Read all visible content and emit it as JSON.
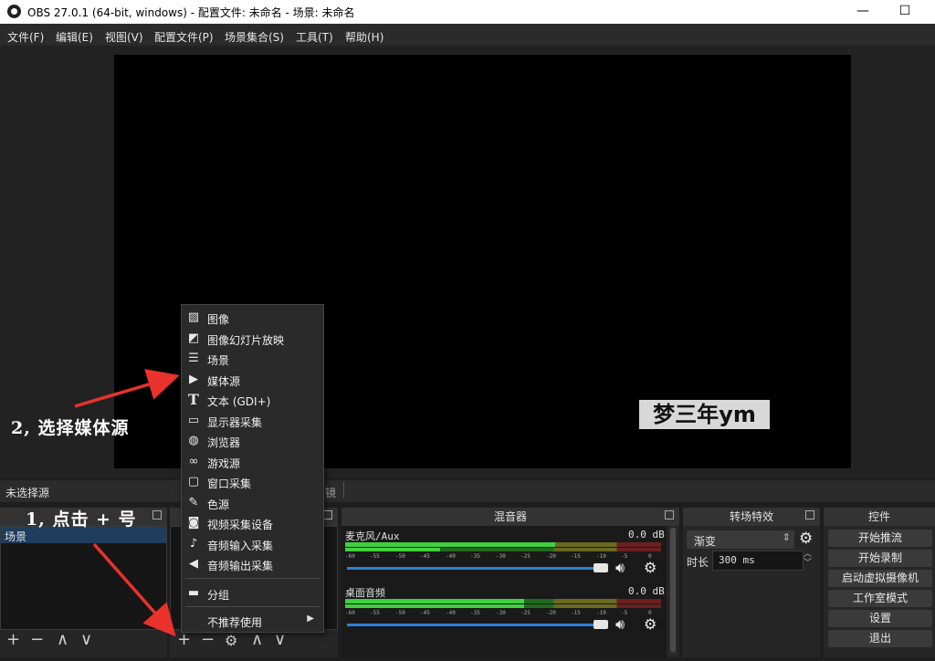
{
  "window": {
    "title": "OBS 27.0.1 (64-bit, windows) - 配置文件: 未命名 - 场景: 未命名",
    "minimize": "—",
    "maximize": "☐"
  },
  "menu": [
    "文件(F)",
    "编辑(E)",
    "视图(V)",
    "配置文件(P)",
    "场景集合(S)",
    "工具(T)",
    "帮助(H)"
  ],
  "preview": {
    "watermark_text": "梦三年ym"
  },
  "source_bar": {
    "no_source": "未选择源",
    "filter_tail": "镜"
  },
  "scenes": {
    "items": [
      "场景"
    ]
  },
  "mixer": {
    "title": "混音器",
    "channels": [
      {
        "name": "麦克风/Aux",
        "level": "0.0 dB"
      },
      {
        "name": "桌面音频",
        "level": "0.0 dB"
      }
    ],
    "scale": [
      "-60",
      "-55",
      "-50",
      "-45",
      "-40",
      "-35",
      "-30",
      "-25",
      "-20",
      "-15",
      "-10",
      "-5",
      "0"
    ]
  },
  "transitions": {
    "title": "转场特效",
    "selected": "渐变",
    "duration_label": "时长",
    "duration_value": "300 ms"
  },
  "controls": {
    "title": "控件",
    "buttons": [
      "开始推流",
      "开始录制",
      "启动虚拟摄像机",
      "工作室模式",
      "设置",
      "退出"
    ]
  },
  "context_menu": {
    "items": [
      "图像",
      "图像幻灯片放映",
      "场景",
      "媒体源",
      "文本 (GDI+)",
      "显示器采集",
      "浏览器",
      "游戏源",
      "窗口采集",
      "色源",
      "视频采集设备",
      "音频输入采集",
      "音频输出采集"
    ],
    "group": "分组",
    "deprecated": "不推荐使用"
  },
  "annotations": {
    "step1": "1, 点击 + 号",
    "step2": "2, 选择媒体源"
  },
  "colors": {
    "arrow": "#e8322b",
    "slider": "#2f7fd6",
    "meter_green": "#3fd13f",
    "meter_yellow": "#c8c23a",
    "meter_red": "#c83a3a"
  }
}
